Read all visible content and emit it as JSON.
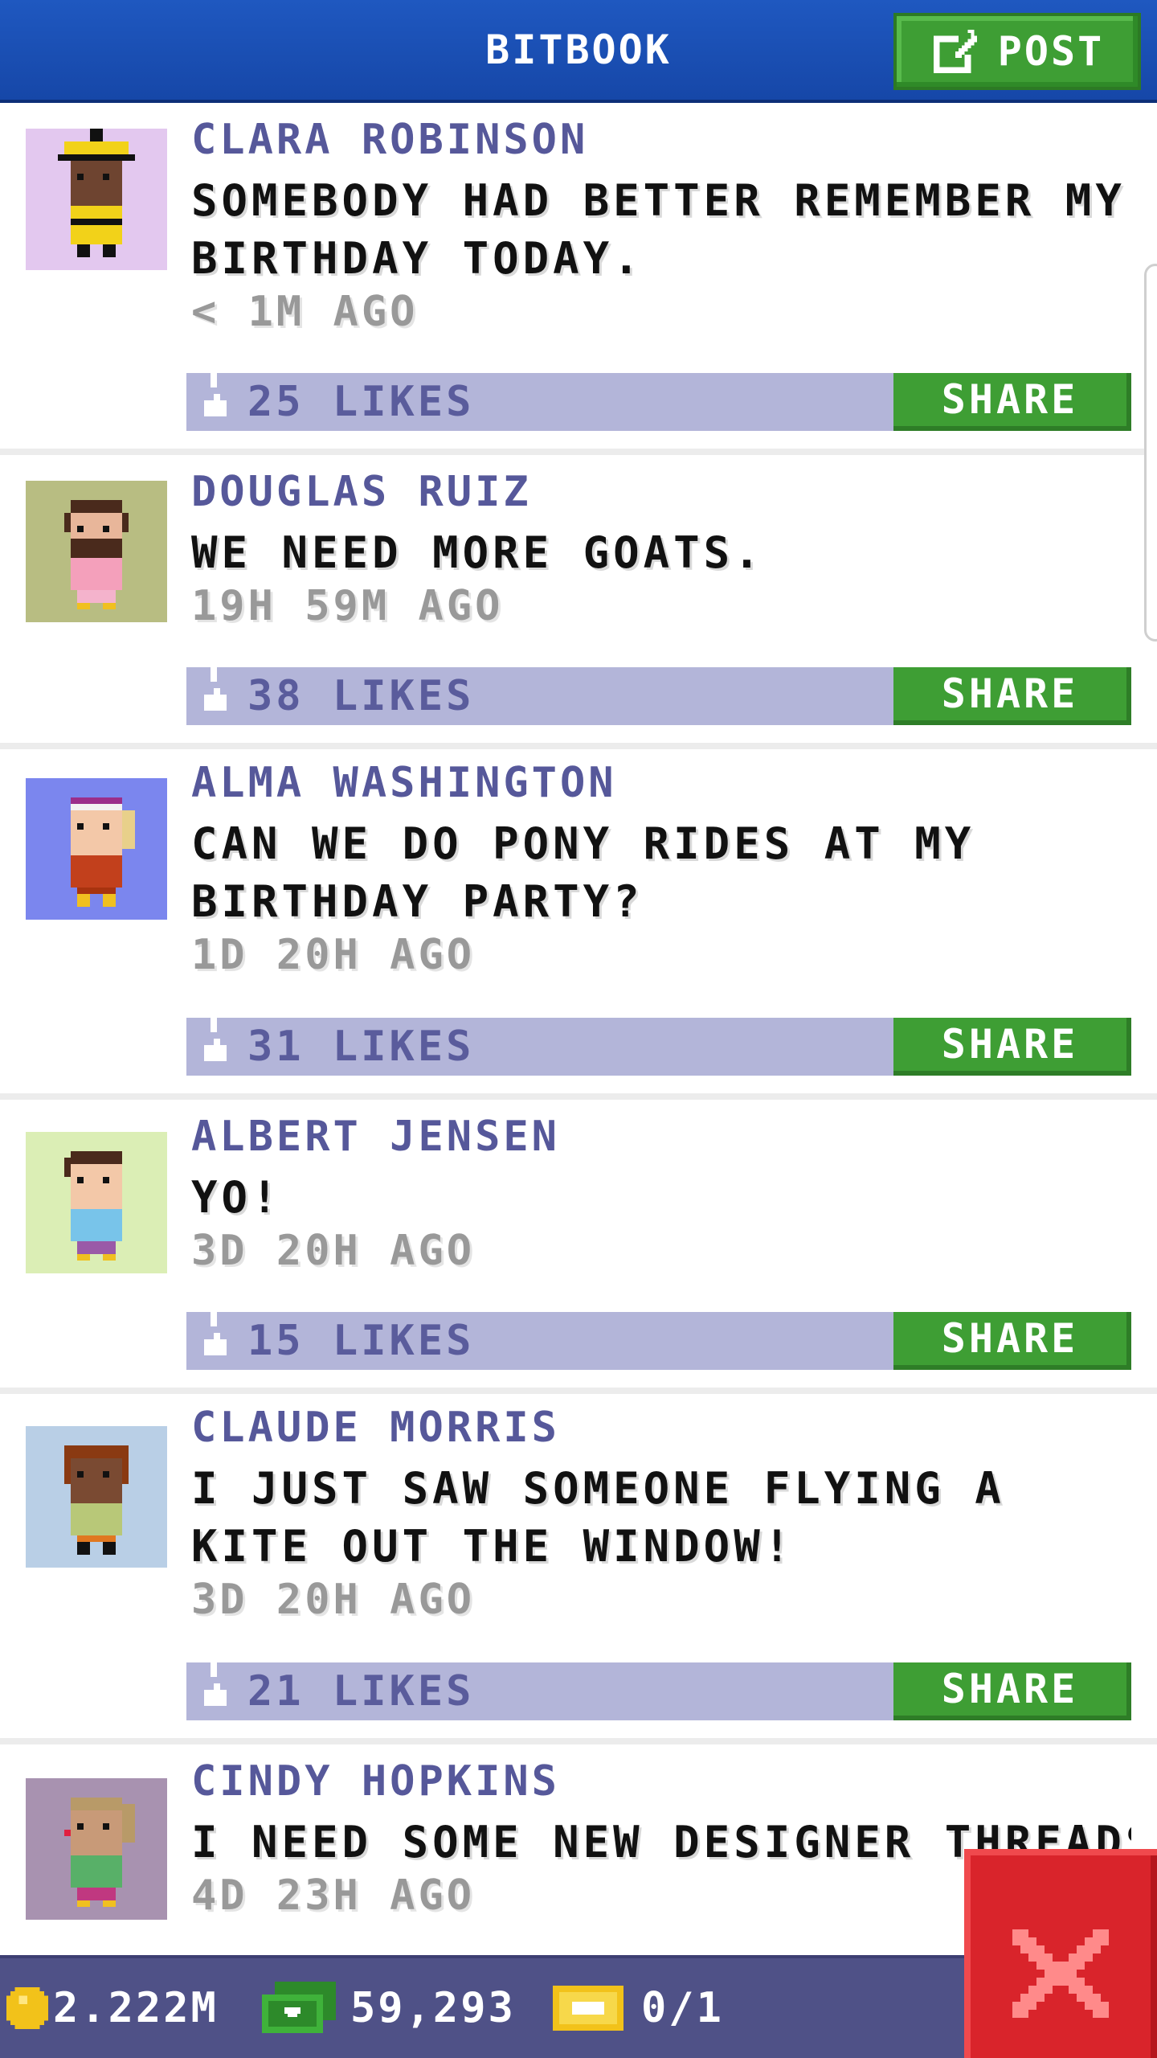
{
  "header": {
    "title": "BITBOOK",
    "post_label": "POST"
  },
  "colors": {
    "header_blue": "#1f58c0",
    "button_green": "#3e9e34",
    "likes_bar": "#b3b5d9",
    "author_purple": "#56589a",
    "close_red": "#d9242b",
    "bottom_bar": "#4f5187"
  },
  "feed": {
    "share_label": "SHARE",
    "posts": [
      {
        "author": "CLARA ROBINSON",
        "message": "SOMEBODY HAD BETTER REMEMBER MY BIRTHDAY TODAY.",
        "time": "< 1M AGO",
        "likes": "25 LIKES"
      },
      {
        "author": "DOUGLAS RUIZ",
        "message": "WE NEED MORE GOATS.",
        "time": "19H 59M AGO",
        "likes": "38 LIKES"
      },
      {
        "author": "ALMA WASHINGTON",
        "message": "CAN WE DO PONY RIDES AT MY BIRTHDAY PARTY?",
        "time": "1D 20H AGO",
        "likes": "31 LIKES"
      },
      {
        "author": "ALBERT JENSEN",
        "message": "YO!",
        "time": "3D 20H AGO",
        "likes": "15 LIKES"
      },
      {
        "author": "CLAUDE MORRIS",
        "message": "I JUST SAW SOMEONE FLYING A KITE OUT THE WINDOW!",
        "time": "3D 20H AGO",
        "likes": "21 LIKES"
      },
      {
        "author": "CINDY HOPKINS",
        "message": "I NEED SOME NEW DESIGNER THREADS",
        "time": "4D 23H AGO",
        "likes": ""
      }
    ]
  },
  "status_bar": {
    "coins": "2.222M",
    "bux": "59,293",
    "tickets": "0/1"
  }
}
